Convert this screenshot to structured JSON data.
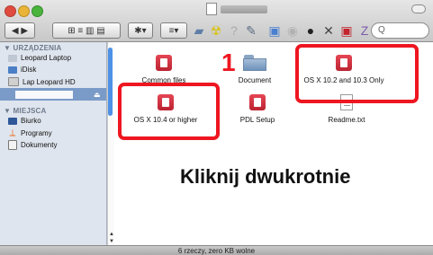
{
  "window": {
    "status_text": "6 rzeczy, zero KB wolne"
  },
  "toolbar": {
    "buttons": [
      {
        "label": "◀ ▶"
      },
      {
        "label": "⊞ ≡ ▥ ▤"
      },
      {
        "label": "✱▾"
      },
      {
        "label": "≡▾"
      }
    ],
    "search_placeholder": "Q"
  },
  "sidebar": {
    "sections": [
      {
        "title": "▼ URZĄDZENIA",
        "items": [
          "Leopard Laptop",
          "iDisk",
          "Lap Leopard HD"
        ]
      },
      {
        "title": "▼ MIEJSCA",
        "items": [
          "Biurko",
          "Programy",
          "Dokumenty"
        ]
      }
    ]
  },
  "files": [
    {
      "name": "Common files"
    },
    {
      "name": "Document"
    },
    {
      "name": "OS X 10.2 and 10.3 Only"
    },
    {
      "name": "OS X 10.4 or higher"
    },
    {
      "name": "PDL Setup"
    },
    {
      "name": "Readme.txt"
    }
  ],
  "annotation": {
    "step_number": "1",
    "instruction": "Kliknij dwukrotnie",
    "color": "#ee1620"
  }
}
